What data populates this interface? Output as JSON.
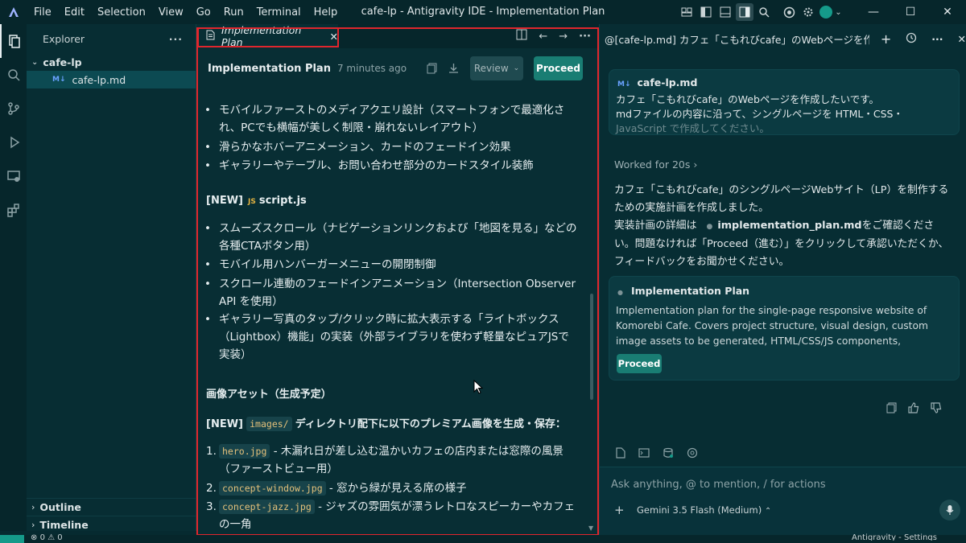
{
  "titlebar": {
    "menu": [
      "File",
      "Edit",
      "Selection",
      "View",
      "Go",
      "Run",
      "Terminal",
      "Help"
    ],
    "title": "cafe-lp - Antigravity IDE - Implementation Plan"
  },
  "explorer": {
    "header": "Explorer",
    "folder": "cafe-lp",
    "file": "cafe-lp.md",
    "file_badge": "M↓",
    "outline": "Outline",
    "timeline": "Timeline"
  },
  "editor": {
    "tab_label": "Implementation Plan",
    "doc_title": "Implementation Plan",
    "doc_time": "7 minutes ago",
    "review_label": "Review",
    "proceed_label": "Proceed",
    "bullets_css": [
      "モバイルファーストのメディアクエリ設計（スマートフォンで最適化され、PCでも横幅が美しく制限・崩れないレイアウト）",
      "滑らかなホバーアニメーション、カードのフェードイン効果",
      "ギャラリーやテーブル、お問い合わせ部分のカードスタイル装飾"
    ],
    "script_new": "[NEW]",
    "script_badge": "JS",
    "script_name": "script.js",
    "bullets_js": [
      "スムーズスクロール（ナビゲーションリンクおよび「地図を見る」などの各種CTAボタン用）",
      "モバイル用ハンバーガーメニューの開閉制御",
      "スクロール連動のフェードインアニメーション（Intersection Observer API を使用）",
      "ギャラリー写真のタップ/クリック時に拡大表示する「ライトボックス（Lightbox）機能」の実装（外部ライブラリを使わず軽量なピュアJSで実装）"
    ],
    "assets_heading": "画像アセット（生成予定）",
    "assets_new": "[NEW]",
    "assets_dir": "images/",
    "assets_desc": "ディレクトリ配下に以下のプレミアム画像を生成・保存：",
    "assets": [
      {
        "num": "1.",
        "file": "hero.jpg",
        "desc": "- 木漏れ日が差し込む温かいカフェの店内または窓際の風景（ファーストビュー用）"
      },
      {
        "num": "2.",
        "file": "concept-window.jpg",
        "desc": "- 窓から緑が見える席の様子"
      },
      {
        "num": "3.",
        "file": "concept-jazz.jpg",
        "desc": "- ジャズの雰囲気が漂うレトロなスピーカーやカフェの一角"
      }
    ]
  },
  "chat": {
    "header": "@[cafe-lp.md] カフェ「こもれびcafe」のWebページを作",
    "user_file": "cafe-lp.md",
    "user_msg_1": "カフェ「こもれびcafe」のWebページを作成したいです。",
    "user_msg_2": "mdファイルの内容に沿って、シングルページを HTML・CSS・",
    "user_msg_3": "JavaScript で作成してください。",
    "worked": "Worked for 20s",
    "resp_1": "カフェ「こもれびcafe」のシングルページWebサイト（LP）を制作するための実施計画を作成しました。",
    "resp_2a": "実装計画の詳細は",
    "resp_2_file": "implementation_plan.md",
    "resp_2b": "をご確認ください。問題なければ「Proceed（進む）」をクリックして承認いただくか、フィードバックをお聞かせください。",
    "card_title": "Implementation Plan",
    "card_desc": "Implementation plan for the single-page responsive website of Komorebi Cafe. Covers project structure, visual design, custom image assets to be generated, HTML/CSS/JS components, interactive feature...",
    "card_button": "Proceed",
    "input_placeholder": "Ask anything, @ to mention, / for actions",
    "model": "Gemini 3.5 Flash (Medium)",
    "status_right": "Antigravity - Settings"
  },
  "statusbar": {
    "errors": "0",
    "warnings": "0"
  }
}
